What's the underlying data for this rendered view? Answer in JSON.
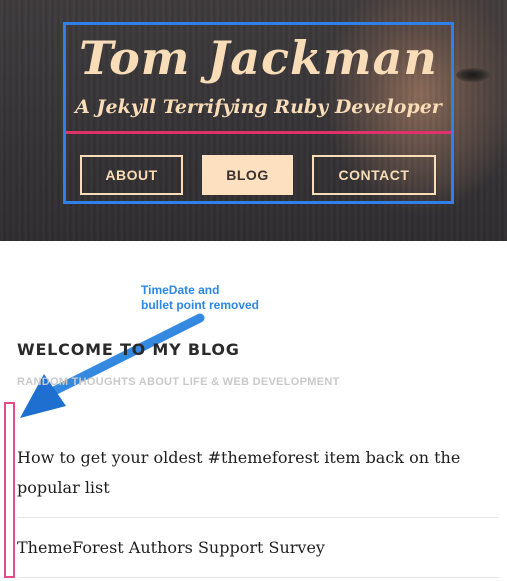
{
  "header": {
    "site_title": "Tom Jackman",
    "site_subtitle": "A Jekyll Terrifying Ruby Developer"
  },
  "nav": {
    "items": [
      {
        "label": "ABOUT",
        "active": false
      },
      {
        "label": "BLOG",
        "active": true
      },
      {
        "label": "CONTACT",
        "active": false
      }
    ]
  },
  "annotation": {
    "line1": "TimeDate and",
    "line2": "bullet point removed"
  },
  "main": {
    "heading": "WELCOME TO MY BLOG",
    "tagline": "RANDOM THOUGHTS ABOUT LIFE & WEB DEVELOPMENT",
    "posts": [
      {
        "title": "How to get your oldest #themeforest item back on the popular list"
      },
      {
        "title": "ThemeForest Authors Support Survey"
      }
    ]
  },
  "colors": {
    "accent_text": "#f9ddb8",
    "active_nav_bg": "#fde0c0",
    "frame_blue": "#2f80e8",
    "underline_pink": "#e0316b",
    "annotation_blue": "#2b88e4",
    "bracket_pink": "#e44b88"
  }
}
